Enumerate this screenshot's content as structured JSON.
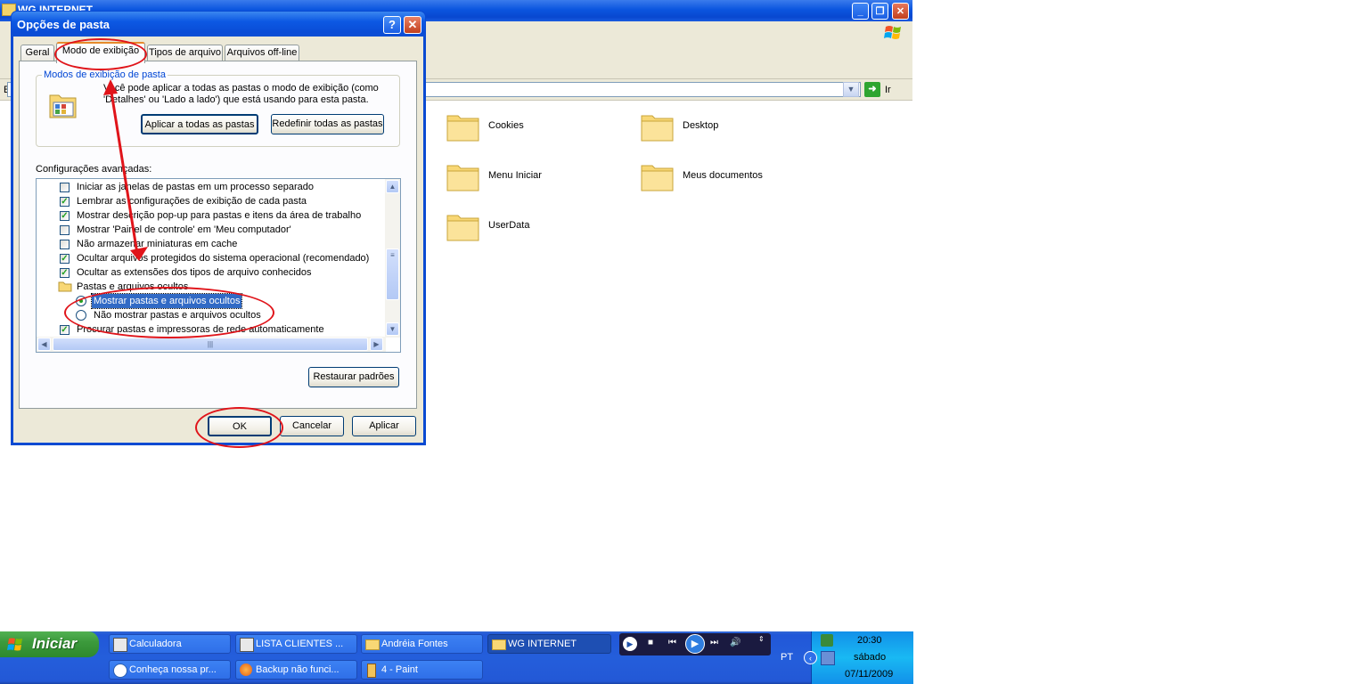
{
  "explorer": {
    "title": "WG INTERNET",
    "address_label": "E",
    "go_label": "Ir",
    "folders": [
      "Cookies",
      "Desktop",
      "Menu Iniciar",
      "Meus documentos",
      "UserData"
    ]
  },
  "dialog": {
    "title": "Opções de pasta",
    "help": "?",
    "close": "✕",
    "tabs": [
      "Geral",
      "Modo de exibição",
      "Tipos de arquivo",
      "Arquivos off-line"
    ],
    "group_title": "Modos de exibição de pasta",
    "group_desc": "Você pode aplicar a todas as pastas o modo de exibição (como 'Detalhes' ou 'Lado a lado') que está usando para esta pasta.",
    "apply_all": "Aplicar a todas as pastas",
    "reset_all": "Redefinir todas as pastas",
    "advanced_label": "Configurações avançadas:",
    "advanced": [
      {
        "type": "check",
        "checked": false,
        "text": "Iniciar as janelas de pastas em um processo separado"
      },
      {
        "type": "check",
        "checked": true,
        "text": "Lembrar as configurações de exibição de cada pasta"
      },
      {
        "type": "check",
        "checked": true,
        "text": "Mostrar descrição pop-up para pastas e itens da área de trabalho"
      },
      {
        "type": "check",
        "checked": false,
        "text": "Mostrar 'Painel de controle' em 'Meu computador'"
      },
      {
        "type": "check",
        "checked": false,
        "text": "Não armazenar miniaturas em cache"
      },
      {
        "type": "check",
        "checked": true,
        "text": "Ocultar arquivos protegidos do sistema operacional (recomendado)"
      },
      {
        "type": "check",
        "checked": true,
        "text": "Ocultar as extensões dos tipos de arquivo conhecidos"
      },
      {
        "type": "folder",
        "text": "Pastas e arquivos ocultos"
      },
      {
        "type": "radio",
        "checked": true,
        "text": "Mostrar pastas e arquivos ocultos"
      },
      {
        "type": "radio",
        "checked": false,
        "text": "Não mostrar pastas e arquivos ocultos"
      },
      {
        "type": "check",
        "checked": true,
        "text": "Procurar pastas e impressoras de rede automaticamente"
      }
    ],
    "restore": "Restaurar padrões",
    "ok": "OK",
    "cancel": "Cancelar",
    "apply": "Aplicar"
  },
  "taskbar": {
    "start": "Iniciar",
    "buttons_row1": [
      "Calculadora",
      "LISTA CLIENTES ...",
      "Andréia Fontes",
      "WG INTERNET"
    ],
    "buttons_row2": [
      "Conheça nossa pr...",
      "Backup não funci...",
      "4 - Paint"
    ],
    "lang": "PT",
    "time": "20:30",
    "day": "sábado",
    "date": "07/11/2009"
  },
  "colors": {
    "annotation": "#e0141a",
    "titlebar": "#0a4cd6",
    "dialog_bg": "#ece9d8"
  }
}
